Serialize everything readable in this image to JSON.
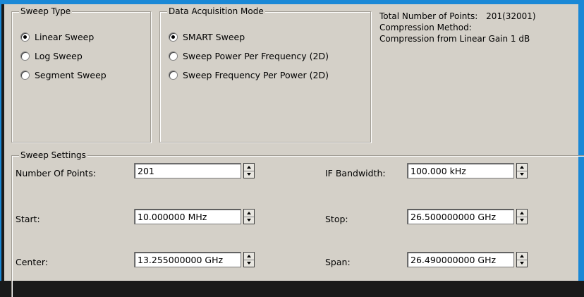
{
  "sweep_type": {
    "title": "Sweep Type",
    "options": [
      {
        "label": "Linear Sweep",
        "selected": true
      },
      {
        "label": "Log Sweep",
        "selected": false
      },
      {
        "label": "Segment Sweep",
        "selected": false
      }
    ]
  },
  "acq_mode": {
    "title": "Data Acquisition Mode",
    "options": [
      {
        "label": "SMART Sweep",
        "selected": true
      },
      {
        "label": "Sweep Power Per Frequency (2D)",
        "selected": false
      },
      {
        "label": "Sweep Frequency Per Power (2D)",
        "selected": false
      }
    ]
  },
  "info": {
    "total_points_label": "Total Number of Points:",
    "total_points_value": "201(32001)",
    "compression_method_label": "Compression Method:",
    "compression_method_value": "Compression from Linear Gain 1 dB"
  },
  "sweep_settings": {
    "title": "Sweep Settings",
    "num_points": {
      "label": "Number Of Points:",
      "value": "201"
    },
    "if_bandwidth": {
      "label": "IF Bandwidth:",
      "value": "100.000 kHz"
    },
    "start": {
      "label": "Start:",
      "value": "10.000000 MHz"
    },
    "stop": {
      "label": "Stop:",
      "value": "26.500000000 GHz"
    },
    "center": {
      "label": "Center:",
      "value": "13.255000000 GHz"
    },
    "span": {
      "label": "Span:",
      "value": "26.490000000 GHz"
    }
  },
  "colors": {
    "accent": "#1a88d6",
    "dialog": "#d4d0c8"
  }
}
